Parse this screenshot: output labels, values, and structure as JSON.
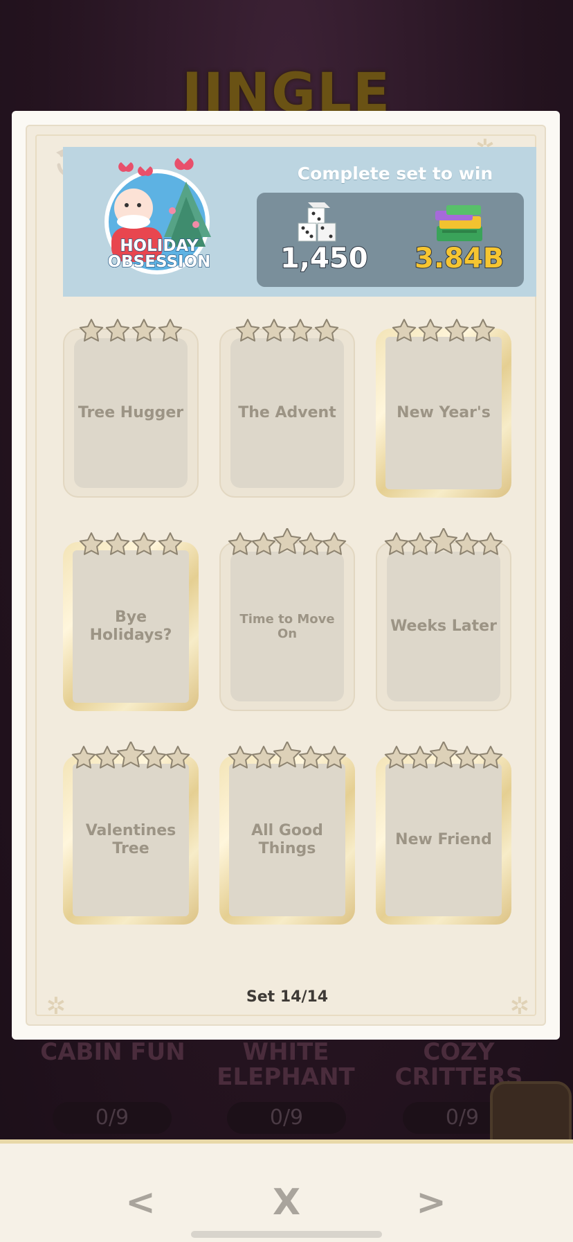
{
  "background": {
    "title": "JINGLE",
    "sets": [
      {
        "name": "CABIN FUN",
        "progress": "0/9"
      },
      {
        "name": "WHITE ELEPHANT",
        "progress": "0/9"
      },
      {
        "name": "COZY CRITTERS",
        "progress": "0/9"
      }
    ]
  },
  "album": {
    "badge_name": "HOLIDAY OBSESSION",
    "complete_text": "Complete set to win",
    "rewards": {
      "dice": "1,450",
      "cash": "3.84B"
    },
    "cards": [
      {
        "name": "Tree Hugger",
        "stars": 4
      },
      {
        "name": "The Advent",
        "stars": 4
      },
      {
        "name": "New Year's",
        "stars": 4
      },
      {
        "name": "Bye Holidays?",
        "stars": 4
      },
      {
        "name": "Time to Move On",
        "stars": 5
      },
      {
        "name": "Weeks Later",
        "stars": 5
      },
      {
        "name": "Valentines Tree",
        "stars": 5
      },
      {
        "name": "All Good Things",
        "stars": 5
      },
      {
        "name": "New Friend",
        "stars": 5
      }
    ],
    "set_counter": "Set 14/14"
  },
  "navigation": {
    "prev": "<",
    "close": "X",
    "next": ">"
  },
  "icons": {
    "history": "history-icon",
    "dice": "dice-icon",
    "cash": "cash-stack-icon",
    "star": "star-icon",
    "prev": "chevron-left-icon",
    "next": "chevron-right-icon",
    "close": "close-icon"
  },
  "colors": {
    "header": "#bcd5e1",
    "reward_box": "#7a8f9b",
    "cash_amount": "#f6c531",
    "gold_frame": "#e5cf92"
  }
}
